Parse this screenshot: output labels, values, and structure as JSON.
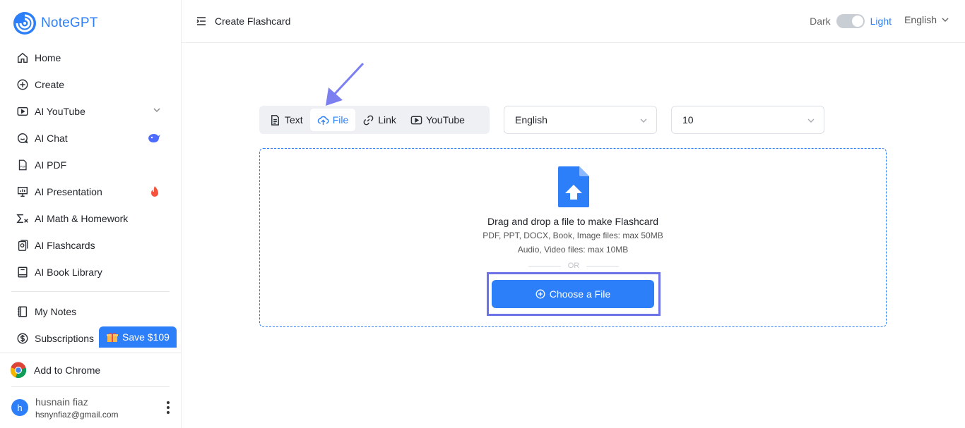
{
  "brand": {
    "name": "NoteGPT"
  },
  "sidebar": {
    "items": [
      {
        "label": "Home",
        "icon": "home-icon"
      },
      {
        "label": "Create",
        "icon": "plus-circle-icon"
      },
      {
        "label": "AI YouTube",
        "icon": "play-icon"
      },
      {
        "label": "AI Chat",
        "icon": "chat-icon"
      },
      {
        "label": "AI PDF",
        "icon": "pdf-icon"
      },
      {
        "label": "AI Presentation",
        "icon": "presentation-icon"
      },
      {
        "label": "AI Math & Homework",
        "icon": "sigma-icon"
      },
      {
        "label": "AI Flashcards",
        "icon": "flashcards-icon"
      },
      {
        "label": "AI Book Library",
        "icon": "book-icon"
      }
    ],
    "secondary": [
      {
        "label": "My Notes",
        "icon": "notebook-icon"
      },
      {
        "label": "Subscriptions",
        "icon": "dollar-icon"
      }
    ],
    "save_badge": "Save $109",
    "add_chrome": "Add to Chrome",
    "user": {
      "initial": "h",
      "name": "husnain fiaz",
      "email": "hsnynfiaz@gmail.com"
    }
  },
  "header": {
    "title": "Create Flashcard",
    "theme_dark": "Dark",
    "theme_light": "Light",
    "language": "English"
  },
  "main": {
    "tabs": [
      {
        "label": "Text",
        "active": false
      },
      {
        "label": "File",
        "active": true
      },
      {
        "label": "Link",
        "active": false
      },
      {
        "label": "YouTube",
        "active": false
      }
    ],
    "language_select": "English",
    "count_select": "10",
    "dropzone": {
      "title": "Drag and drop a file to make Flashcard",
      "line1": "PDF, PPT, DOCX, Book, Image files: max 50MB",
      "line2": "Audio, Video files: max 10MB",
      "or": "OR",
      "button": "Choose a File"
    }
  },
  "colors": {
    "accent": "#2d7ff9",
    "annotation": "#6d72e6"
  }
}
